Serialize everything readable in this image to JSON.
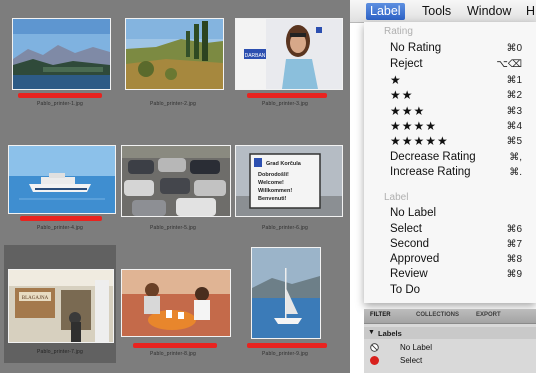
{
  "menubar": {
    "items": [
      "Label",
      "Tools",
      "Window",
      "H"
    ],
    "active": "Label"
  },
  "menu": {
    "rating_header": "Rating",
    "rating_items": [
      {
        "label": "No Rating",
        "shortcut": "⌘0"
      },
      {
        "label": "Reject",
        "shortcut": "⌥⌫"
      },
      {
        "label": "★",
        "shortcut": "⌘1"
      },
      {
        "label": "★★",
        "shortcut": "⌘2"
      },
      {
        "label": "★★★",
        "shortcut": "⌘3"
      },
      {
        "label": "★★★★",
        "shortcut": "⌘4"
      },
      {
        "label": "★★★★★",
        "shortcut": "⌘5"
      },
      {
        "label": "Decrease Rating",
        "shortcut": "⌘,"
      },
      {
        "label": "Increase Rating",
        "shortcut": "⌘."
      }
    ],
    "label_header": "Label",
    "label_items": [
      {
        "label": "No Label",
        "shortcut": ""
      },
      {
        "label": "Select",
        "shortcut": "⌘6"
      },
      {
        "label": "Second",
        "shortcut": "⌘7"
      },
      {
        "label": "Approved",
        "shortcut": "⌘8"
      },
      {
        "label": "Review",
        "shortcut": "⌘9"
      },
      {
        "label": "To Do",
        "shortcut": ""
      }
    ]
  },
  "filter_panel": {
    "tabs": [
      "FILTER",
      "COLLECTIONS",
      "EXPORT"
    ],
    "active_tab": "FILTER",
    "section": "Labels",
    "rows": [
      {
        "label": "No Label",
        "icon": "no-label-icon"
      },
      {
        "label": "Select",
        "icon": "red-dot-icon",
        "color": "#d8211d"
      }
    ]
  },
  "grid": {
    "label_color": "#e8231f",
    "thumbnails": [
      {
        "filename": "Pablo_printer-1.jpg",
        "subject": "coastal-mountains",
        "red_label": true
      },
      {
        "filename": "Pablo_printer-2.jpg",
        "subject": "hillside-cypress",
        "red_label": false
      },
      {
        "filename": "Pablo_printer-3.jpg",
        "subject": "woman-with-sign",
        "red_label": true
      },
      {
        "filename": "Pablo_printer-4.jpg",
        "subject": "ferry-boat",
        "red_label": true
      },
      {
        "filename": "Pablo_printer-5.jpg",
        "subject": "parking-lot",
        "red_label": false
      },
      {
        "filename": "Pablo_printer-6.jpg",
        "subject": "welcome-sign",
        "red_label": false
      },
      {
        "filename": "Pablo_printer-7.jpg",
        "subject": "cafe-storefront",
        "red_label": false
      },
      {
        "filename": "Pablo_printer-8.jpg",
        "subject": "people-at-table",
        "red_label": true
      },
      {
        "filename": "Pablo_printer-9.jpg",
        "subject": "sailboat",
        "red_label": true
      }
    ]
  },
  "sign_text": {
    "sign3": "DARBAN",
    "sign6": [
      "Grad Korčula",
      "Dobrodošli!",
      "Welcome!",
      "Willkommen!",
      "Benvenuti!"
    ],
    "sign7": "BLAGAJNA"
  }
}
